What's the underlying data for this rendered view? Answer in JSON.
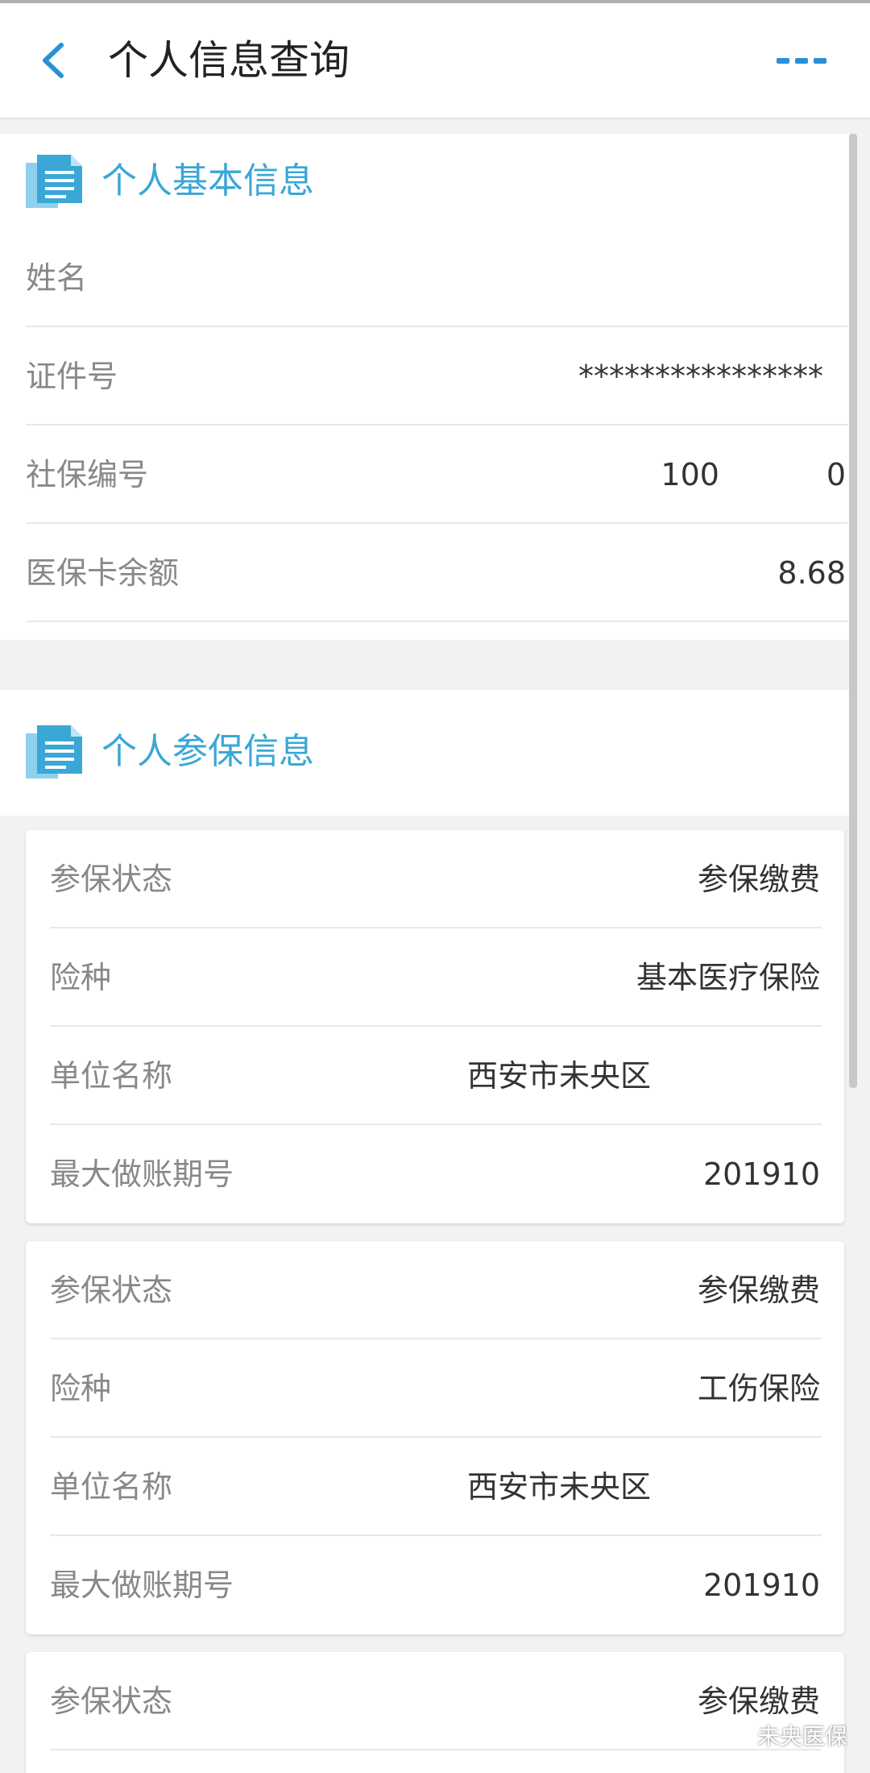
{
  "nav": {
    "title": "个人信息查询"
  },
  "basic": {
    "title": "个人基本信息",
    "rows": [
      {
        "label": "姓名",
        "value": ""
      },
      {
        "label": "证件号",
        "value": "****************"
      },
      {
        "label": "社保编号",
        "value": "100           0"
      },
      {
        "label": "医保卡余额",
        "value": "8.68"
      }
    ]
  },
  "insurance": {
    "title": "个人参保信息",
    "cards": [
      {
        "rows": [
          {
            "label": "参保状态",
            "value": "参保缴费"
          },
          {
            "label": "险种",
            "value": "基本医疗保险"
          },
          {
            "label": "单位名称",
            "value": "西安市未央区"
          },
          {
            "label": "最大做账期号",
            "value": "201910"
          }
        ]
      },
      {
        "rows": [
          {
            "label": "参保状态",
            "value": "参保缴费"
          },
          {
            "label": "险种",
            "value": "工伤保险"
          },
          {
            "label": "单位名称",
            "value": "西安市未央区"
          },
          {
            "label": "最大做账期号",
            "value": "201910"
          }
        ]
      },
      {
        "rows": [
          {
            "label": "参保状态",
            "value": "参保缴费"
          }
        ]
      }
    ]
  },
  "watermark": {
    "text": "未央医保"
  },
  "icons": {
    "back": "chevron-left-icon",
    "more": "more-dots-icon",
    "section": "document-icon"
  },
  "colors": {
    "accent": "#3aa7d6",
    "label": "#888888",
    "value": "#333333"
  }
}
